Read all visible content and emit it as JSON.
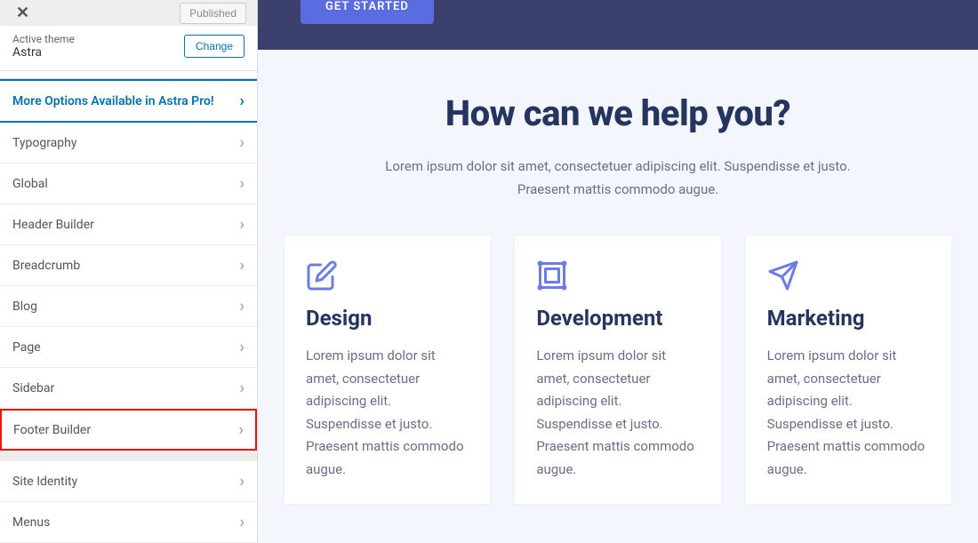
{
  "topbar": {
    "published": "Published"
  },
  "theme": {
    "label": "Active theme",
    "name": "Astra",
    "change": "Change"
  },
  "more_link": "More Options Available in Astra Pro!",
  "nav": {
    "typography": "Typography",
    "global": "Global",
    "header_builder": "Header Builder",
    "breadcrumb": "Breadcrumb",
    "blog": "Blog",
    "page": "Page",
    "sidebar": "Sidebar",
    "footer_builder": "Footer Builder",
    "site_identity": "Site Identity",
    "menus": "Menus"
  },
  "preview": {
    "cta": "GET STARTED",
    "heading": "How can we help you?",
    "subtext": "Lorem ipsum dolor sit amet, consectetuer adipiscing elit. Suspendisse et justo. Praesent mattis commodo augue.",
    "cards": [
      {
        "title": "Design",
        "desc": "Lorem ipsum dolor sit amet, consectetuer adipiscing elit. Suspendisse et justo. Praesent mattis commodo augue."
      },
      {
        "title": "Development",
        "desc": "Lorem ipsum dolor sit amet, consectetuer adipiscing elit. Suspendisse et justo. Praesent mattis commodo augue."
      },
      {
        "title": "Marketing",
        "desc": "Lorem ipsum dolor sit amet, consectetuer adipiscing elit. Suspendisse et justo. Praesent mattis commodo augue."
      }
    ]
  }
}
